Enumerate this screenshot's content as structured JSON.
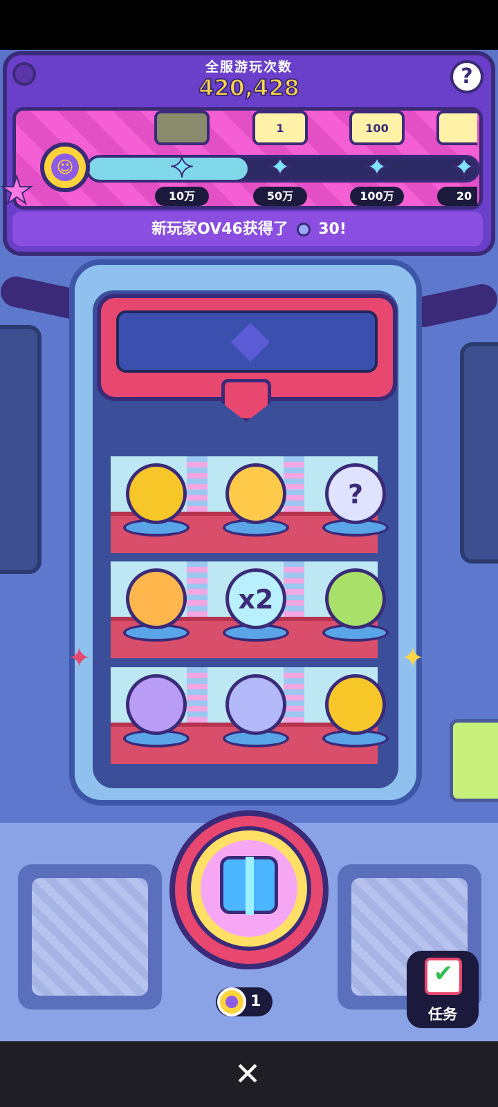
{
  "header": {
    "title": "全服游玩次数",
    "play_count": "420,428",
    "help_label": "?"
  },
  "progress": {
    "fill_fraction": 0.41,
    "milestones": [
      {
        "threshold": "10万",
        "reward": "",
        "reward_icon": "ticket-icon",
        "claimed": true
      },
      {
        "threshold": "50万",
        "reward": "1",
        "reward_icon": "chest-icon",
        "claimed": false
      },
      {
        "threshold": "100万",
        "reward": "100",
        "reward_icon": "gem-icon",
        "claimed": false
      },
      {
        "threshold": "20",
        "reward": "",
        "reward_icon": "gift-icon",
        "claimed": false
      }
    ]
  },
  "news": {
    "prefix": "新玩家OV46获得了",
    "amount": "30!"
  },
  "machine": {
    "items": [
      {
        "name": "gold-candy-item",
        "icon": "candy-icon",
        "text": "",
        "color": "#f7c72a"
      },
      {
        "name": "dog-badge-item",
        "icon": "dog-icon",
        "text": "",
        "color": "#ffc94a"
      },
      {
        "name": "mystery-box-item",
        "icon": "question-box-icon",
        "text": "?",
        "color": "#dfe3ff"
      },
      {
        "name": "chicken-badge-item",
        "icon": "chicken-icon",
        "text": "",
        "color": "#ffb74d"
      },
      {
        "name": "x2-ticket-item",
        "icon": "ticket-icon",
        "text": "x2",
        "color": "#b8f0ff"
      },
      {
        "name": "cat-badge-item",
        "icon": "cat-icon",
        "text": "",
        "color": "#a8e06a"
      },
      {
        "name": "capsule-item",
        "icon": "capsule-icon",
        "text": "",
        "color": "#b99cf5"
      },
      {
        "name": "gems-item",
        "icon": "gem-icon",
        "text": "",
        "color": "#b2b8f8"
      },
      {
        "name": "gold-candy-item-2",
        "icon": "candy-icon",
        "text": "",
        "color": "#f7c72a"
      }
    ]
  },
  "controls": {
    "token_count": "1",
    "task_label": "任务"
  },
  "colors": {
    "header_purple": "#6a3fc9",
    "accent_pink": "#e8476f",
    "gold": "#ffd64a"
  }
}
